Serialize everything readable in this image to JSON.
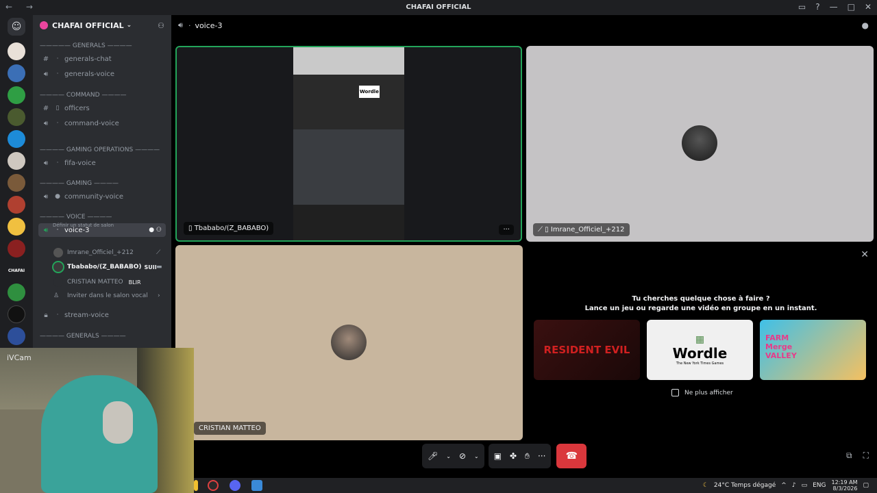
{
  "window": {
    "title": "CHAFAI OFFICIAL"
  },
  "guild": {
    "name": "CHAFAI OFFICIAL"
  },
  "sidebar": {
    "categories": {
      "generals": "————— GENERALS ————",
      "command": "———— COMMAND ————",
      "gaming_ops": "———— GAMING OPERATIONS ————",
      "gaming": "———— GAMING ————",
      "voice": "———— VOICE ————",
      "generals2": "———— GENERALS ————"
    },
    "channels": {
      "generals_chat": "generals-chat",
      "generals_voice": "generals-voice",
      "officers": "officers",
      "command_voice": "command-voice",
      "fifa_voice": "fifa-voice",
      "community_voice": "community-voice",
      "voice_3": "voice-3",
      "stream_voice": "stream-voice"
    },
    "status_prompt": "Définir un statut de salon",
    "members": {
      "m1": "Imrane_Officiel_+212",
      "m2": "Tbababo/(Z_BABABO)",
      "m2_badge": "SUII",
      "m3": "CRISTIAN MATTEO",
      "m3_badge": "BLIR"
    },
    "invite_label": "Inviter dans le salon vocal",
    "server_label": "CHAFAI"
  },
  "topbar": {
    "channel": "voice-3"
  },
  "tiles": {
    "tile1_label": "Tbababo/(Z_BABABO)",
    "tile2_label": "Imrane_Officiel_+212",
    "tile3_label": "CRISTIAN MATTEO",
    "tile1_screen_text": "Wordle"
  },
  "activity": {
    "question": "Tu cherches quelque chose à faire ?",
    "subtitle": "Lance un jeu ou regarde une vidéo en groupe en un instant.",
    "cards": [
      "RESIDENT EVIL",
      "Wordle",
      "FARM Merge VALLEY"
    ],
    "wordle_sub": "The New York Times Games",
    "dont_show": "Ne plus afficher"
  },
  "webcam": {
    "label": "iVCam"
  },
  "taskbar": {
    "weather": "24°C  Temps dégagé",
    "lang": "ENG",
    "time": "12:19 AM",
    "date": "8/3/2026"
  },
  "colors": {
    "accent": "#5865f2",
    "speaking": "#23a55a",
    "hangup": "#da373c"
  }
}
